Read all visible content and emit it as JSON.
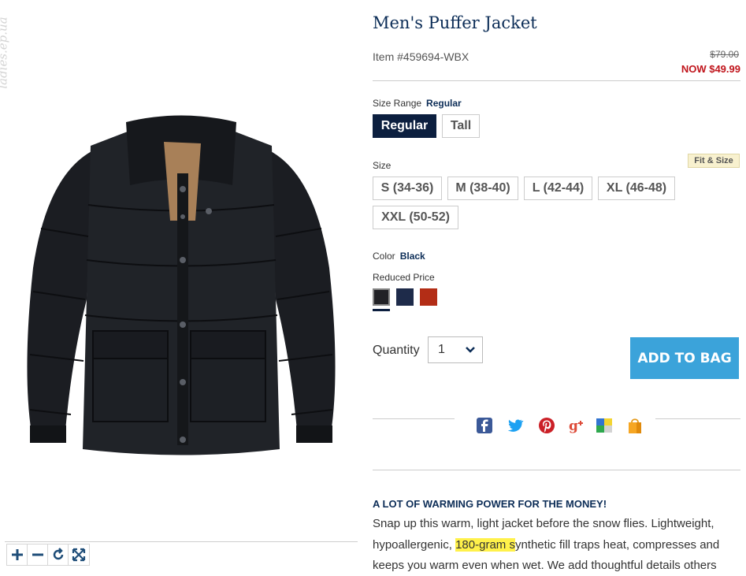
{
  "watermark": "ladies.ep.ua",
  "product": {
    "title": "Men's Puffer Jacket",
    "item_number": "Item #459694-WBX",
    "price_old": "$79.00",
    "price_now": "NOW $49.99"
  },
  "size_range": {
    "label": "Size Range",
    "selected": "Regular",
    "options": [
      "Regular",
      "Tall"
    ]
  },
  "size": {
    "label": "Size",
    "fit_link": "Fit & Size",
    "options": [
      "S (34-36)",
      "M (38-40)",
      "L (42-44)",
      "XL (46-48)",
      "XXL (50-52)"
    ]
  },
  "color": {
    "label": "Color",
    "selected": "Black",
    "group_label": "Reduced Price",
    "swatches": [
      {
        "name": "Black",
        "hex": "#222226"
      },
      {
        "name": "Navy",
        "hex": "#1e2b4a"
      },
      {
        "name": "Rust",
        "hex": "#b32d16"
      }
    ]
  },
  "quantity": {
    "label": "Quantity",
    "value": "1"
  },
  "add_to_bag": "ADD TO BAG",
  "share_icons": [
    "facebook-icon",
    "twitter-icon",
    "pinterest-icon",
    "google-plus-icon",
    "delicious-icon",
    "shopping-bag-icon"
  ],
  "description": {
    "title": "A LOT OF WARMING POWER FOR THE MONEY!",
    "line1": "Snap up this warm, light jacket before the snow flies. Lightweight,",
    "line2_pre": "hypoallergenic, ",
    "line2_highlight": "180-gram s",
    "line2_post": "ynthetic fill traps heat, compresses and",
    "line3": "keeps you warm even when wet. We add thoughtful details others"
  },
  "colors": {
    "navy": "#0c2d57",
    "sale_red": "#c0141b",
    "cta_blue": "#3ba3da",
    "highlight": "#fff14a"
  }
}
